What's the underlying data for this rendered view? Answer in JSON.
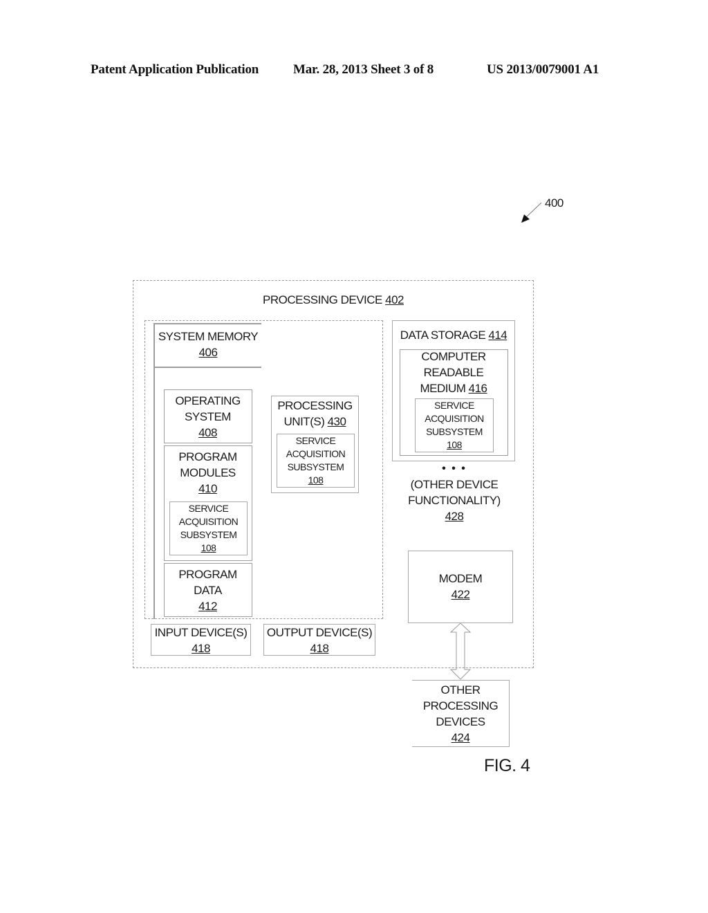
{
  "header": {
    "publication": "Patent Application Publication",
    "date_sheet": "Mar. 28, 2013  Sheet 3 of 8",
    "patent_number": "US 2013/0079001 A1"
  },
  "figure": {
    "reference": "400",
    "caption": "FIG. 4",
    "processing_device": {
      "label": "PROCESSING DEVICE ",
      "ref": "402"
    },
    "system_memory": {
      "label": "SYSTEM MEMORY",
      "ref": "406"
    },
    "operating_system": {
      "line1": "OPERATING",
      "line2": "SYSTEM",
      "ref": "408"
    },
    "program_modules": {
      "line1": "PROGRAM",
      "line2": "MODULES",
      "ref": "410"
    },
    "program_data": {
      "line1": "PROGRAM",
      "line2": "DATA",
      "ref": "412"
    },
    "service_acquisition": {
      "line1": "SERVICE",
      "line2": "ACQUISITION",
      "line3": "SUBSYSTEM",
      "ref": "108"
    },
    "processing_units": {
      "line1": "PROCESSING",
      "line2": "UNIT(S) ",
      "ref": "430"
    },
    "data_storage": {
      "label": "DATA STORAGE ",
      "ref": "414"
    },
    "computer_readable_medium": {
      "line1": "COMPUTER",
      "line2": "READABLE",
      "line3": "MEDIUM ",
      "ref": "416"
    },
    "other_functionality": {
      "dots": "• • •",
      "line1": "(OTHER DEVICE",
      "line2": "FUNCTIONALITY)",
      "ref": "428"
    },
    "modem": {
      "label": "MODEM",
      "ref": "422"
    },
    "input_devices": {
      "label": "INPUT DEVICE(S)",
      "ref": "418"
    },
    "output_devices": {
      "label": "OUTPUT DEVICE(S)",
      "ref": "418"
    },
    "other_processing_devices": {
      "line1": "OTHER",
      "line2": "PROCESSING",
      "line3": "DEVICES",
      "ref": "424"
    }
  }
}
